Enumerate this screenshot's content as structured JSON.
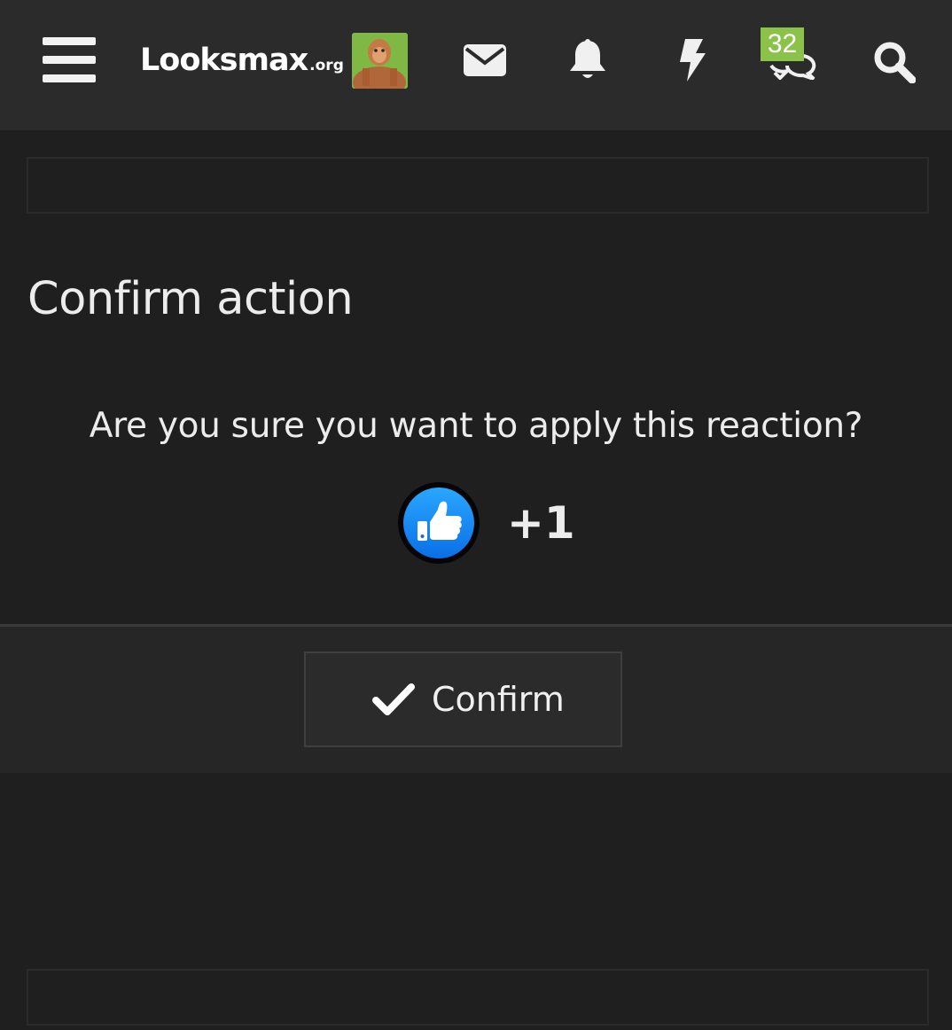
{
  "header": {
    "logo_main": "Looksmax",
    "logo_sub": ".org",
    "conversations_badge": "32",
    "icons": [
      "menu-icon",
      "avatar",
      "mail-icon",
      "bell-icon",
      "bolt-icon",
      "conversations-icon",
      "search-icon"
    ]
  },
  "dialog": {
    "title": "Confirm action",
    "question": "Are you sure you want to apply this reaction?",
    "reaction": {
      "icon": "thumbs-up-icon",
      "label": "+1",
      "color": "#1a8cff"
    },
    "confirm_label": "Confirm"
  },
  "colors": {
    "background": "#1f1f1f",
    "header": "#2b2b2b",
    "badge": "#8bc34a",
    "text": "#ececec"
  }
}
